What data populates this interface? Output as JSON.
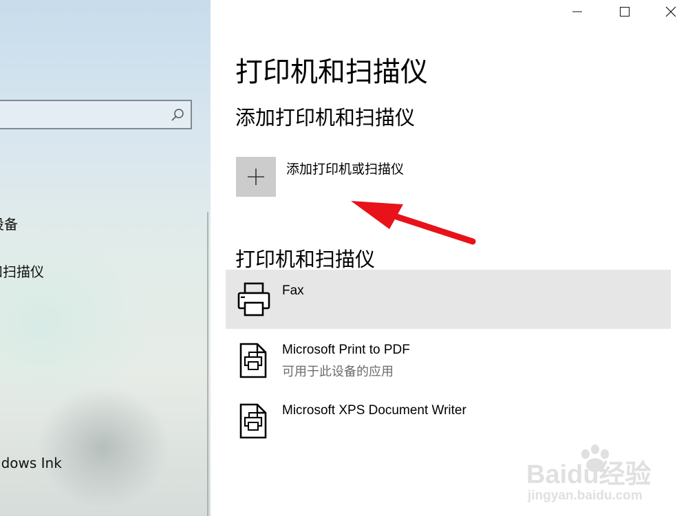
{
  "left": {
    "search": {
      "value": "",
      "placeholder": ""
    },
    "nav": [
      {
        "label": "蓝牙和其他设备"
      },
      {
        "label": "打印机和扫描仪"
      },
      {
        "label": "Windows Ink"
      }
    ]
  },
  "main": {
    "title": "打印机和扫描仪",
    "add_section_title": "添加打印机和扫描仪",
    "add_button_label": "添加打印机或扫描仪",
    "list_section_title": "打印机和扫描仪",
    "devices": [
      {
        "name": "Fax",
        "subtitle": "",
        "icon": "fax-printer-icon",
        "selected": true
      },
      {
        "name": "Microsoft Print to PDF",
        "subtitle": "可用于此设备的应用",
        "icon": "document-printer-icon",
        "selected": false
      },
      {
        "name": "Microsoft XPS Document Writer",
        "subtitle": "",
        "icon": "document-printer-icon",
        "selected": false
      }
    ]
  },
  "annotation": {
    "arrow_color": "#e8121a"
  },
  "watermark": {
    "brand": "Baidu经验",
    "url": "jingyan.baidu.com"
  }
}
